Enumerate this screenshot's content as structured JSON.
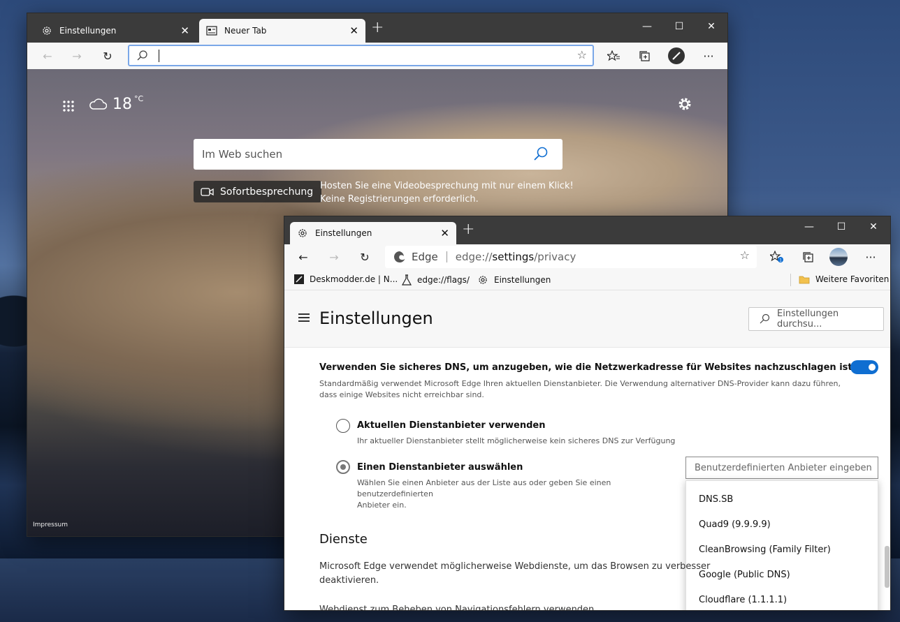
{
  "window1": {
    "tabs": [
      {
        "label": "Einstellungen",
        "icon": "gear-icon"
      },
      {
        "label": "Neuer Tab",
        "icon": "news-icon"
      }
    ],
    "weather": {
      "temp": "18",
      "unit": "°C"
    },
    "search_placeholder": "Im Web suchen",
    "meet_button": "Sofortbesprechung",
    "meet_text_line1": "Hosten Sie eine Videobesprechung mit nur einem Klick!",
    "meet_text_line2": "Keine Registrierungen erforderlich.",
    "impressum": "Impressum"
  },
  "window2": {
    "tab": {
      "label": "Einstellungen",
      "icon": "gear-icon"
    },
    "address": {
      "site": "Edge",
      "url_prefix": "edge://",
      "url_highlight": "settings",
      "url_suffix": "/privacy"
    },
    "favorites": [
      {
        "label": "Deskmodder.de | N...",
        "icon": "pen-icon"
      },
      {
        "label": "edge://flags/",
        "icon": "flask-icon"
      },
      {
        "label": "Einstellungen",
        "icon": "gear-icon"
      }
    ],
    "other_favorites": "Weitere Favoriten",
    "settings": {
      "title": "Einstellungen",
      "search_placeholder": "Einstellungen durchsu...",
      "dns_heading": "Verwenden Sie sicheres DNS, um anzugeben, wie die Netzwerkadresse für Websites nachzuschlagen ist.",
      "dns_desc": "Standardmäßig verwendet Microsoft Edge Ihren aktuellen Dienstanbieter. Die Verwendung alternativer DNS-Provider kann dazu führen, dass einige Websites nicht erreichbar sind.",
      "dns_toggle_on": true,
      "option1_title": "Aktuellen Dienstanbieter verwenden",
      "option1_desc": "Ihr aktueller Dienstanbieter stellt möglicherweise kein sicheres DNS zur Verfügung",
      "option2_title": "Einen Dienstanbieter auswählen",
      "option2_desc_line1": "Wählen Sie einen Anbieter aus der Liste aus oder geben Sie einen benutzerdefinierten",
      "option2_desc_line2": "Anbieter ein.",
      "custom_placeholder": "Benutzerdefinierten Anbieter eingeben",
      "providers": [
        "DNS.SB",
        "Quad9 (9.9.9.9)",
        "CleanBrowsing (Family Filter)",
        "Google (Public DNS)",
        "Cloudflare (1.1.1.1)"
      ],
      "dienste_title": "Dienste",
      "dienste_desc_line1": "Microsoft Edge verwendet möglicherweise Webdienste, um das Browsen zu verbesser",
      "dienste_desc_line2": "deaktivieren.",
      "dienste_cut": "Webdienst zum Beheben von Navigationsfehlern verwenden"
    }
  },
  "colors": {
    "accent": "#0f6ed1",
    "titlebar": "#3b3b3b",
    "toolbar": "#f7f7f7"
  }
}
